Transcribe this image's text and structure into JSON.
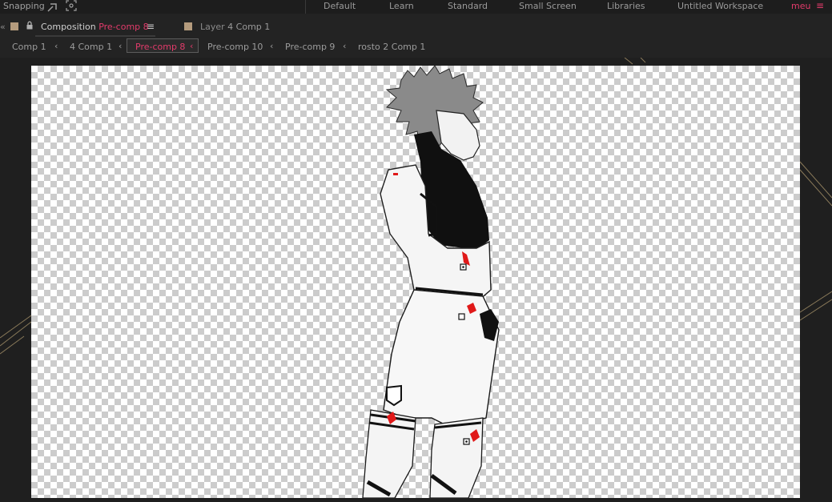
{
  "topbar": {
    "snapping_label": "Snapping",
    "workspaces": [
      "Default",
      "Learn",
      "Standard",
      "Small Screen",
      "Libraries",
      "Untitled Workspace"
    ],
    "active_workspace": "meu",
    "accent_color": "#e23b6b"
  },
  "panel": {
    "tab_label": "Composition",
    "tab_comp": "Pre-comp 8",
    "layer_label": "Layer",
    "layer_name": "4 Comp 1",
    "label_color": "#b49b7d"
  },
  "breadcrumbs": {
    "items": [
      "Comp 1",
      "4 Comp 1",
      "Pre-comp 8",
      "Pre-comp 10",
      "Pre-comp 9",
      "rosto 2 Comp 1"
    ],
    "active": "Pre-comp 8"
  },
  "icons": {
    "snapping": "snap-magnet-icon",
    "focus": "focus-target-icon",
    "lock": "lock-icon",
    "panel_menu": "hamburger-menu-icon",
    "workspace_menu": "workspace-menu-icon",
    "puppet_pin": "puppet-pin-icon"
  }
}
